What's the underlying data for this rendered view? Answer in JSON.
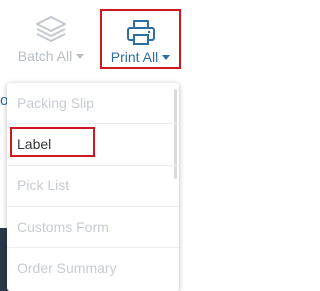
{
  "toolbar": {
    "batch_all": {
      "label": "Batch All",
      "icon": "layers-icon"
    },
    "print_all": {
      "label": "Print All",
      "icon": "printer-icon"
    }
  },
  "print_menu": {
    "items": [
      {
        "label": "Packing Slip",
        "state": "muted"
      },
      {
        "label": "Label",
        "state": "active"
      },
      {
        "label": "Pick List",
        "state": "muted"
      },
      {
        "label": "Customs Form",
        "state": "muted"
      },
      {
        "label": "Order Summary",
        "state": "muted"
      }
    ]
  },
  "colors": {
    "accent": "#2d6fa3",
    "highlight_border": "#d0171d",
    "muted_text": "#c7ccd3",
    "active_text": "#33383d",
    "dark_panel": "#2b3a4a"
  }
}
